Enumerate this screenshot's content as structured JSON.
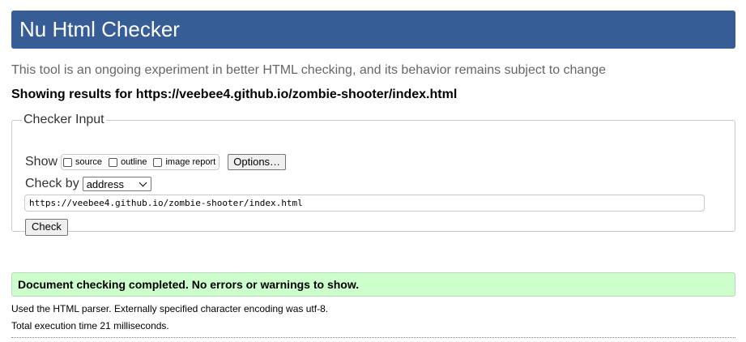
{
  "header": {
    "title": "Nu Html Checker",
    "brand_color": "#365d95"
  },
  "tagline": "This tool is an ongoing experiment in better HTML checking, and its behavior remains subject to change",
  "showing_results": "Showing results for https://veebee4.github.io/zombie-shooter/index.html",
  "checker_input": {
    "legend": "Checker Input",
    "show_label": "Show",
    "show_options": [
      {
        "label": "source",
        "checked": false
      },
      {
        "label": "outline",
        "checked": false
      },
      {
        "label": "image report",
        "checked": false
      }
    ],
    "options_button": "Options…",
    "check_by_label": "Check by",
    "check_by_selected": "address",
    "url_value": "https://veebee4.github.io/zombie-shooter/index.html",
    "check_button": "Check"
  },
  "result": {
    "message": "Document checking completed. No errors or warnings to show.",
    "color": "#ccffcc"
  },
  "details": {
    "parser_line": "Used the HTML parser. Externally specified character encoding was utf-8.",
    "time_line": "Total execution time 21 milliseconds."
  }
}
